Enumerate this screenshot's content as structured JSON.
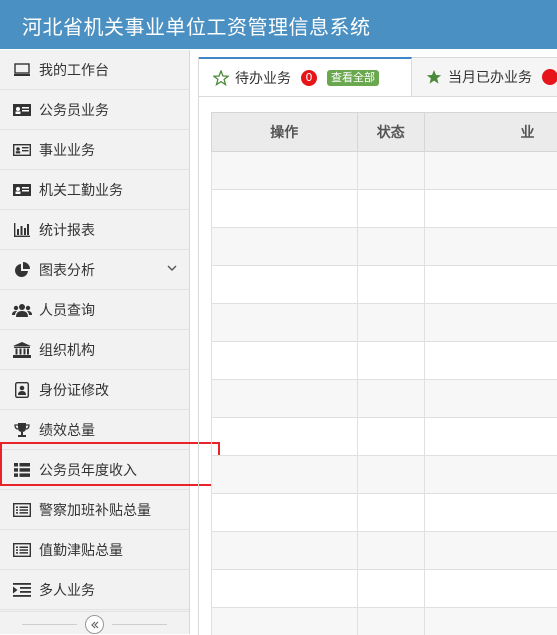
{
  "app": {
    "title": "河北省机关事业单位工资管理信息系统"
  },
  "sidebar": {
    "items": [
      {
        "label": "我的工作台",
        "icon": "monitor-icon"
      },
      {
        "label": "公务员业务",
        "icon": "id-card-icon"
      },
      {
        "label": "事业业务",
        "icon": "id-card-outline-icon"
      },
      {
        "label": "机关工勤业务",
        "icon": "id-card-icon"
      },
      {
        "label": "统计报表",
        "icon": "bar-chart-icon"
      },
      {
        "label": "图表分析",
        "icon": "pie-chart-icon"
      },
      {
        "label": "人员查询",
        "icon": "users-icon"
      },
      {
        "label": "组织机构",
        "icon": "institution-icon"
      },
      {
        "label": "身份证修改",
        "icon": "contact-card-icon"
      },
      {
        "label": "绩效总量",
        "icon": "trophy-icon"
      },
      {
        "label": "公务员年度收入",
        "icon": "list-icon"
      },
      {
        "label": "警察加班补贴总量",
        "icon": "list-alt-icon"
      },
      {
        "label": "值勤津贴总量",
        "icon": "list-alt-icon"
      },
      {
        "label": "多人业务",
        "icon": "indent-icon"
      }
    ],
    "highlighted_item": "公务员年度收入"
  },
  "tabs": {
    "pending": {
      "label": "待办业务",
      "count": "0",
      "view_all": "查看全部"
    },
    "done": {
      "label": "当月已办业务"
    }
  },
  "table": {
    "headers": [
      "操作",
      "状态",
      "业"
    ]
  },
  "colors": {
    "header_bg": "#4a90c2",
    "accent": "#3e86c7",
    "badge": "#e5151a",
    "pill": "#6aa84f",
    "highlight": "#e8242a"
  }
}
